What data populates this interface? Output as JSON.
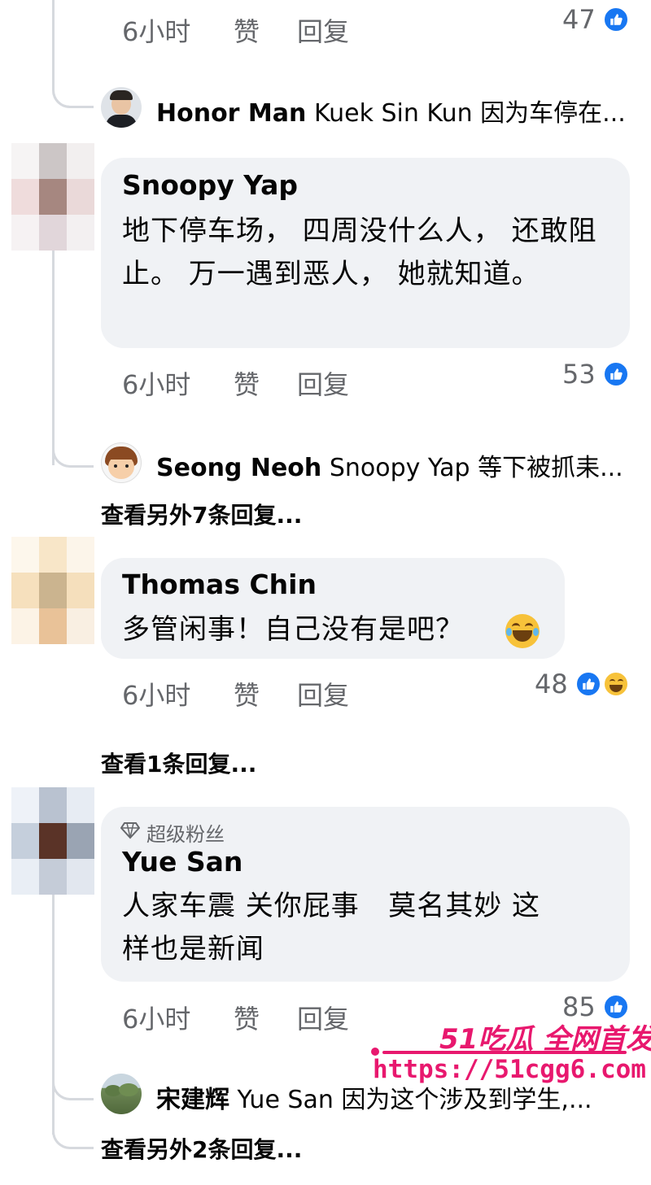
{
  "comments_top": {
    "time": "6小时",
    "like_label": "赞",
    "reply_label": "回复",
    "reaction_count": "47",
    "reply_preview": {
      "name": "Honor Man",
      "text": "Kuek Sin Kun 因为车停在..."
    }
  },
  "comment_snoopy": {
    "author": "Snoopy Yap",
    "text": "地下停车场， 四周没什么人， 还敢阻止。 万一遇到恶人， 她就知道。",
    "time": "6小时",
    "like_label": "赞",
    "reply_label": "回复",
    "reaction_count": "53",
    "reply_preview": {
      "name": "Seong Neoh",
      "text": "Snoopy Yap 等下被抓耒..."
    },
    "more_replies": "查看另外7条回复..."
  },
  "comment_thomas": {
    "author": "Thomas Chin",
    "text": "多管闲事！自己没有是吧？",
    "time": "6小时",
    "like_label": "赞",
    "reply_label": "回复",
    "reaction_count": "48",
    "more_replies": "查看1条回复..."
  },
  "comment_yue": {
    "badge": "超级粉丝",
    "author": "Yue San",
    "text_line1": "人家车震 关你屁事   莫名其妙 这",
    "text_line2": "样也是新闻",
    "time": "6小时",
    "like_label": "赞",
    "reply_label": "回复",
    "reaction_count": "85",
    "reply_preview": {
      "name": "宋建辉",
      "text": "Yue San 因为这个涉及到学生,..."
    },
    "more_replies": "查看另外2条回复..."
  },
  "watermark": {
    "line1": "51吃瓜 全网首发",
    "line2": "https://51cgg6.com"
  },
  "colors": {
    "like_blue": "#1877f2",
    "bubble_bg": "#f0f2f5",
    "meta_gray": "#65676b",
    "watermark_pink": "#e8186e"
  },
  "icons": [
    "like-icon",
    "haha-icon",
    "diamond-icon",
    "avatar"
  ]
}
